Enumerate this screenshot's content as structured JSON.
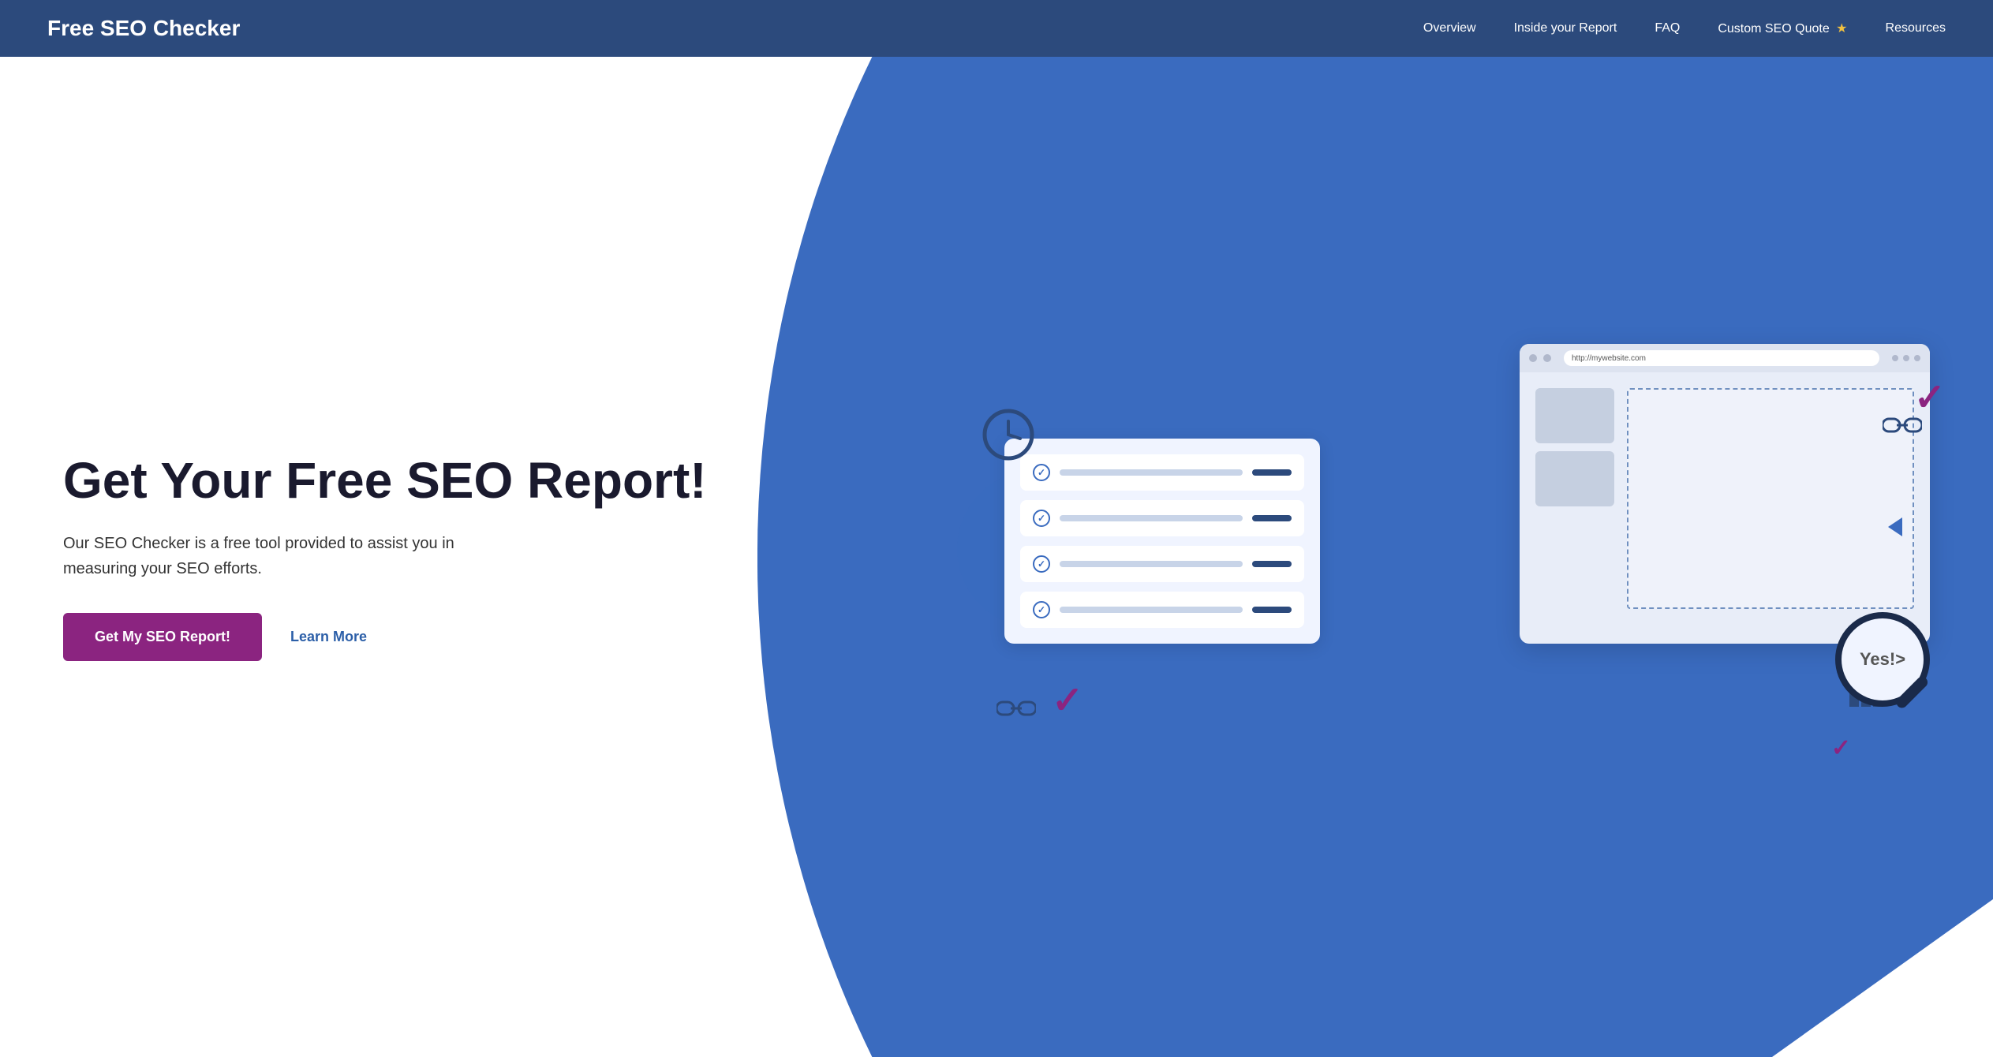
{
  "navbar": {
    "logo": "Free SEO Checker",
    "links": [
      {
        "label": "Overview",
        "href": "#"
      },
      {
        "label": "Inside your Report",
        "href": "#"
      },
      {
        "label": "FAQ",
        "href": "#"
      },
      {
        "label": "Custom SEO Quote",
        "href": "#",
        "has_star": true
      },
      {
        "label": "Resources",
        "href": "#"
      }
    ]
  },
  "hero": {
    "title": "Get Your Free SEO Report!",
    "description": "Our SEO Checker is a free tool provided to assist you in measuring your SEO efforts.",
    "cta_button_label": "Get My SEO Report!",
    "learn_more_label": "Learn More",
    "browser_url": "http://mywebsite.com",
    "magnifier_text": "Yes!>",
    "checklist_items": [
      {
        "checked": true
      },
      {
        "checked": true
      },
      {
        "checked": true
      },
      {
        "checked": true
      }
    ]
  },
  "colors": {
    "navbar_bg": "#2c4a7c",
    "hero_bg": "#ffffff",
    "hero_accent": "#3a6bbf",
    "cta_bg": "#8b2480",
    "learn_more": "#2c5fa8",
    "title_color": "#1a1a2e"
  }
}
